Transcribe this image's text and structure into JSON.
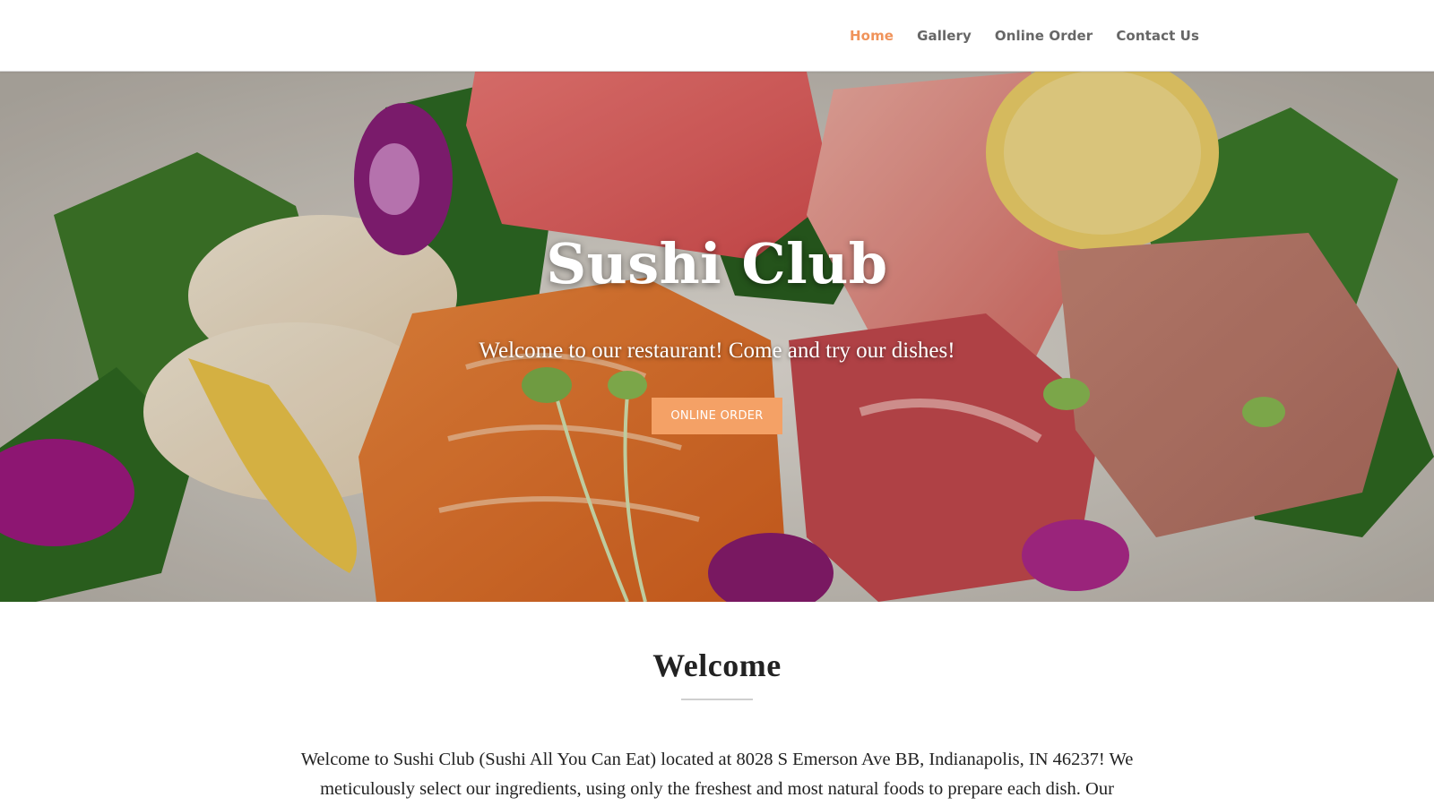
{
  "nav": {
    "items": [
      {
        "label": "Home",
        "active": true
      },
      {
        "label": "Gallery",
        "active": false
      },
      {
        "label": "Online Order",
        "active": false
      },
      {
        "label": "Contact Us",
        "active": false
      }
    ],
    "active_color": "#f0935a",
    "text_color": "#666666"
  },
  "hero": {
    "title": "Sushi Club",
    "subtitle": "Welcome to our restaurant! Come and try our dishes!",
    "button_label": "ONLINE ORDER",
    "button_color": "#f4a166",
    "background_image": "sashimi-platter"
  },
  "welcome": {
    "title": "Welcome",
    "paragraph": "Welcome to Sushi Club (Sushi All You Can Eat) located at 8028 S Emerson Ave BB, Indianapolis, IN 46237! We meticulously select our ingredients, using only the freshest and most natural foods to prepare each dish. Our"
  }
}
